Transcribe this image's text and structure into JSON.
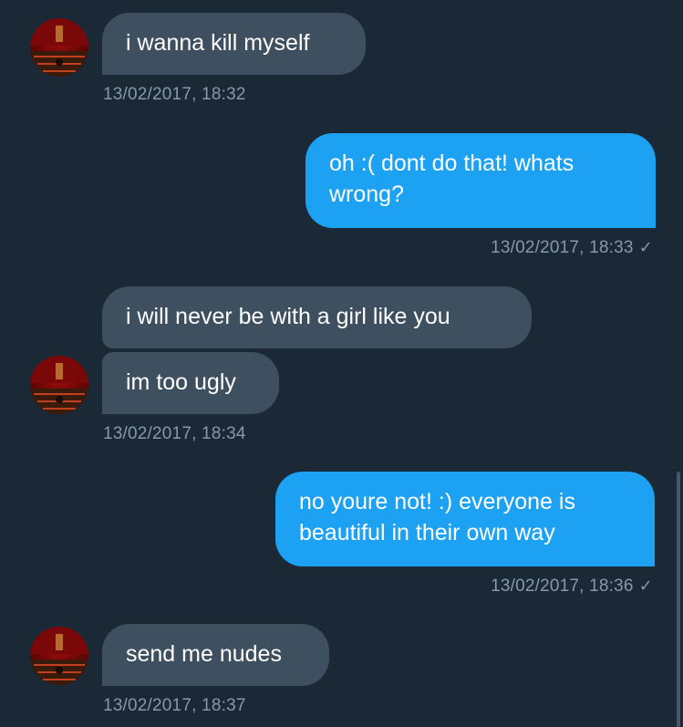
{
  "messages": [
    {
      "id": "m1",
      "dir": "in",
      "text": "i wanna kill myself",
      "time": "13/02/2017, 18:32"
    },
    {
      "id": "m2",
      "dir": "out",
      "text": "oh :( dont do that! whats wrong?",
      "time": "13/02/2017, 18:33"
    },
    {
      "id": "m3",
      "dir": "in",
      "text": "i will never be with a girl like you"
    },
    {
      "id": "m4",
      "dir": "in",
      "text": "im too ugly",
      "time": "13/02/2017, 18:34"
    },
    {
      "id": "m5",
      "dir": "out",
      "text": "no youre not! :) everyone is beautiful in their own way",
      "time": "13/02/2017, 18:36"
    },
    {
      "id": "m6",
      "dir": "in",
      "text": "send me nudes",
      "time": "13/02/2017, 18:37"
    }
  ],
  "read_receipt_icon": "checkmark-icon",
  "avatar_icon": "contact-avatar-icon",
  "colors": {
    "background": "#1b2836",
    "incoming_bubble": "#3e4f60",
    "outgoing_bubble": "#1da1f2",
    "timestamp": "#8899a6"
  }
}
